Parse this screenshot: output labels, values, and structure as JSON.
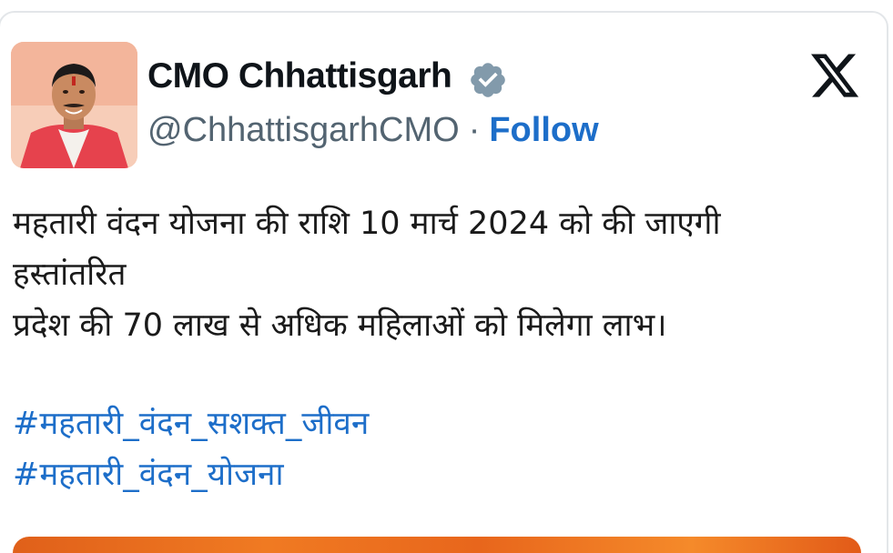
{
  "account": {
    "display_name": "CMO Chhattisgarh",
    "handle": "@ChhattisgarhCMO",
    "separator": "·",
    "follow_label": "Follow",
    "verified_icon": "verified-badge-icon"
  },
  "brand": {
    "logo_icon": "x-logo-icon",
    "link_color": "#1d6ec9",
    "badge_color": "#829aab"
  },
  "tweet": {
    "lines": [
      "महतारी वंदन योजना की राशि 10 मार्च 2024 को की जाएगी",
      "हस्तांतरित",
      "प्रदेश की 70 लाख से अधिक महिलाओं को मिलेगा लाभ।"
    ],
    "hashtags": [
      "#महतारी_वंदन_सशक्त_जीवन",
      "#महतारी_वंदन_योजना"
    ]
  }
}
